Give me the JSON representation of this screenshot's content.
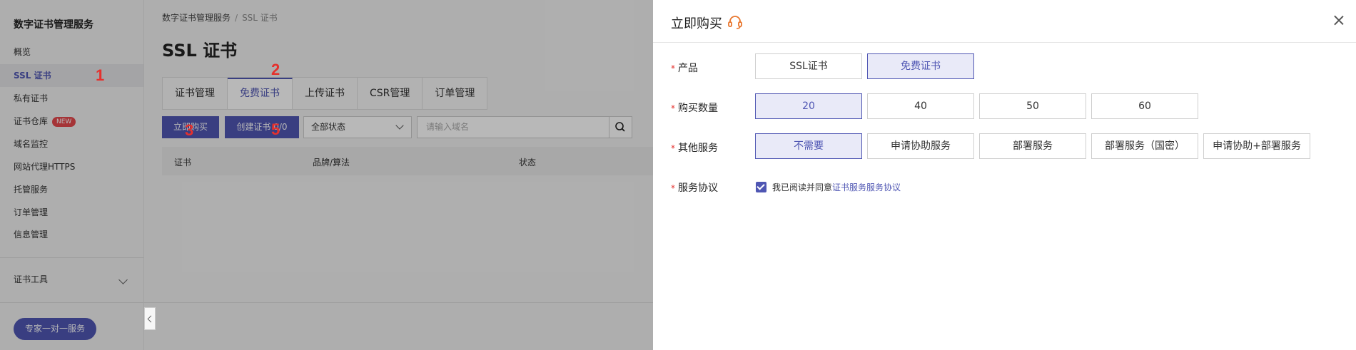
{
  "sidebar": {
    "title": "数字证书管理服务",
    "items": [
      {
        "label": "概览"
      },
      {
        "label": "SSL 证书",
        "active": true
      },
      {
        "label": "私有证书"
      },
      {
        "label": "证书仓库",
        "badge": "NEW"
      },
      {
        "label": "域名监控"
      },
      {
        "label": "网站代理HTTPS"
      },
      {
        "label": "托管服务"
      },
      {
        "label": "订单管理"
      },
      {
        "label": "信息管理"
      }
    ],
    "tools_label": "证书工具",
    "expert_button": "专家一对一服务"
  },
  "annotations": [
    "1",
    "2",
    "3",
    "4",
    "5"
  ],
  "main": {
    "breadcrumb": [
      "数字证书管理服务",
      "SSL 证书"
    ],
    "page_title": "SSL 证书",
    "tabs": [
      {
        "label": "证书管理"
      },
      {
        "label": "免费证书",
        "active": true
      },
      {
        "label": "上传证书"
      },
      {
        "label": "CSR管理"
      },
      {
        "label": "订单管理"
      }
    ],
    "buy_button": "立即购买",
    "create_button": "创建证书 0/0",
    "status_select": "全部状态",
    "search_placeholder": "请输入域名",
    "table_columns": [
      "证书",
      "品牌/算法",
      "状态"
    ]
  },
  "drawer": {
    "title": "立即购买",
    "product": {
      "label": "产品",
      "options": [
        "SSL证书",
        "免费证书"
      ],
      "selected": "免费证书"
    },
    "quantity": {
      "label": "购买数量",
      "options": [
        "20",
        "40",
        "50",
        "60"
      ],
      "selected": "20"
    },
    "services": {
      "label": "其他服务",
      "options": [
        "不需要",
        "申请协助服务",
        "部署服务",
        "部署服务（国密）",
        "申请协助+部署服务"
      ],
      "selected": "不需要"
    },
    "agreement": {
      "label": "服务协议",
      "text": "我已阅读并同意",
      "link": "证书服务服务协议",
      "checked": true
    },
    "required_mark": "*"
  },
  "colors": {
    "accent": "#4f56b3",
    "annotation": "#e5312d",
    "headset": "#e8762d"
  }
}
